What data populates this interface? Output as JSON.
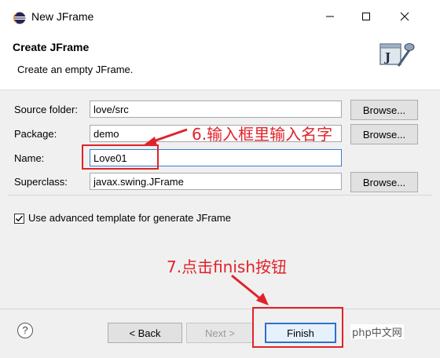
{
  "window": {
    "title": "New JFrame"
  },
  "header": {
    "title": "Create JFrame",
    "description": "Create an empty JFrame."
  },
  "form": {
    "source_folder": {
      "label": "Source folder:",
      "value": "love/src"
    },
    "package": {
      "label": "Package:",
      "value": "demo"
    },
    "name": {
      "label": "Name:",
      "value": "Love01"
    },
    "superclass": {
      "label": "Superclass:",
      "value": "javax.swing.JFrame"
    },
    "browse_label": "Browse...",
    "advanced_template": {
      "label": "Use advanced template for generate JFrame",
      "checked": true
    }
  },
  "footer": {
    "help_symbol": "?",
    "back_label": "< Back",
    "next_label": "Next >",
    "finish_label": "Finish"
  },
  "annotations": {
    "step6": "6.输入框里输入名字",
    "step7": "7.点击finish按钮",
    "color": "#e0232a"
  },
  "watermark": "php中文网",
  "icons": [
    "eclipse-logo-icon",
    "minimize-icon",
    "maximize-icon",
    "close-icon",
    "jframe-wizard-icon",
    "checkmark-icon",
    "help-icon"
  ]
}
